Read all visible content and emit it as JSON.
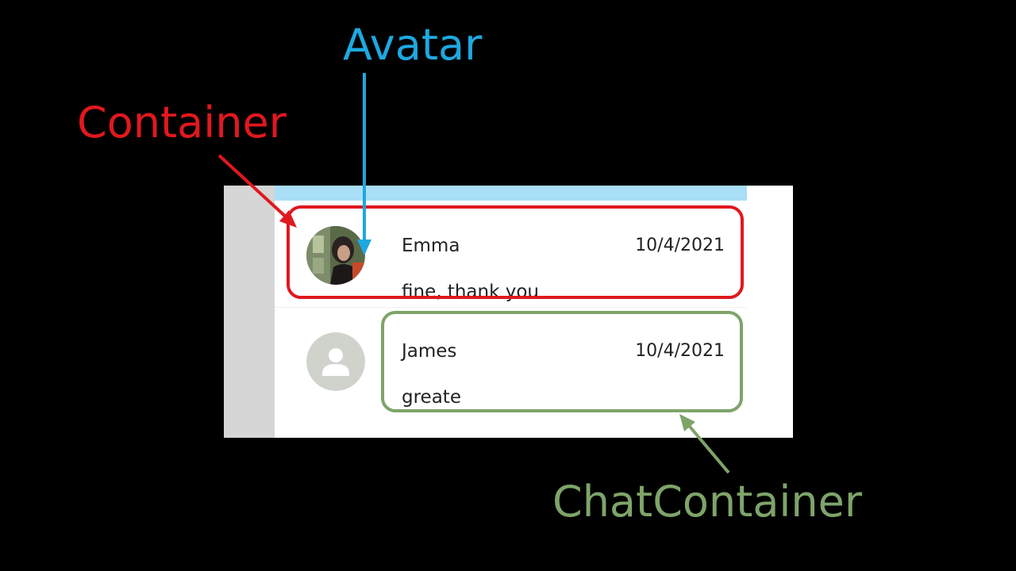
{
  "annotations": {
    "container_label": "Container",
    "avatar_label": "Avatar",
    "chat_container_label": "ChatContainer"
  },
  "colors": {
    "container": "#e0181f",
    "avatar": "#1ea8e0",
    "chat_container": "#7ea46a",
    "top_bar": "#a9dff7",
    "left_strip": "#d6d6d6"
  },
  "chat_list": [
    {
      "name": "Emma",
      "date": "10/4/2021",
      "message": "fine, thank you",
      "avatar_icon": "photo-avatar-icon"
    },
    {
      "name": "James",
      "date": "10/4/2021",
      "message": "greate",
      "avatar_icon": "default-user-avatar-icon"
    }
  ]
}
